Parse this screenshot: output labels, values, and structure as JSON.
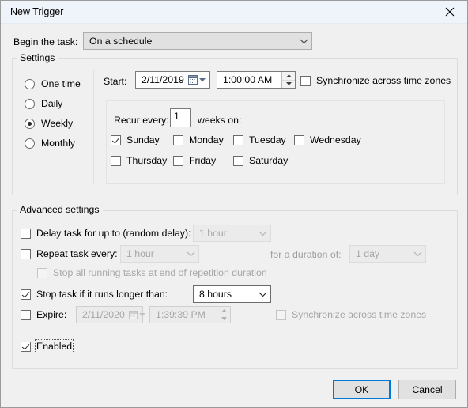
{
  "window": {
    "title": "New Trigger",
    "close_icon": "close-icon"
  },
  "begin": {
    "label": "Begin the task:",
    "value": "On a schedule"
  },
  "settings": {
    "group_title": "Settings",
    "schedule_options": [
      {
        "label": "One time",
        "selected": false
      },
      {
        "label": "Daily",
        "selected": false
      },
      {
        "label": "Weekly",
        "selected": true
      },
      {
        "label": "Monthly",
        "selected": false
      }
    ],
    "start_label": "Start:",
    "start_date": "2/11/2019",
    "start_time": "1:00:00 AM",
    "sync_timezones_label": "Synchronize across time zones",
    "sync_timezones_checked": false,
    "recur_label": "Recur every:",
    "recur_value": "1",
    "recur_unit_label": "weeks on:",
    "days": [
      {
        "label": "Sunday",
        "checked": true
      },
      {
        "label": "Monday",
        "checked": false
      },
      {
        "label": "Tuesday",
        "checked": false
      },
      {
        "label": "Wednesday",
        "checked": false
      },
      {
        "label": "Thursday",
        "checked": false
      },
      {
        "label": "Friday",
        "checked": false
      },
      {
        "label": "Saturday",
        "checked": false
      }
    ]
  },
  "advanced": {
    "group_title": "Advanced settings",
    "delay_label": "Delay task for up to (random delay):",
    "delay_checked": false,
    "delay_value": "1 hour",
    "repeat_label": "Repeat task every:",
    "repeat_checked": false,
    "repeat_value": "1 hour",
    "duration_label": "for a duration of:",
    "duration_value": "1 day",
    "stop_all_label": "Stop all running tasks at end of repetition duration",
    "stop_all_checked": false,
    "stop_task_label": "Stop task if it runs longer than:",
    "stop_task_checked": true,
    "stop_task_value": "8 hours",
    "expire_label": "Expire:",
    "expire_checked": false,
    "expire_date": "2/11/2020",
    "expire_time": "1:39:39 PM",
    "expire_sync_label": "Synchronize across time zones",
    "expire_sync_checked": false,
    "enabled_label": "Enabled",
    "enabled_checked": true
  },
  "footer": {
    "ok_label": "OK",
    "cancel_label": "Cancel"
  },
  "colors": {
    "accent": "#0078d7",
    "dialog_bg": "#f0f0f0",
    "titlebar_bg": "#eff4fb",
    "disabled_text": "#a6a6a6"
  }
}
